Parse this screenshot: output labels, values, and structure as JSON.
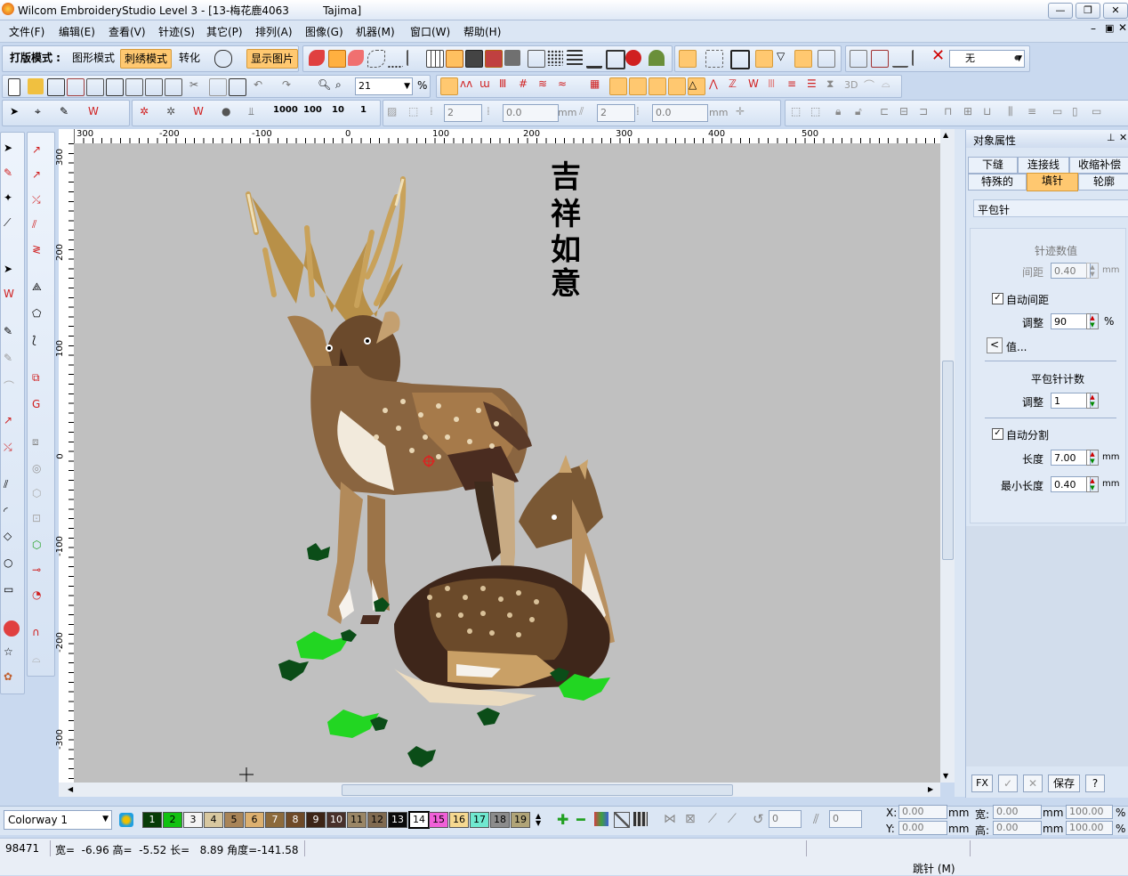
{
  "window": {
    "title": "Wilcom EmbroideryStudio Level 3 - [13-梅花鹿4063          Tajima]"
  },
  "menubar": {
    "items": [
      "文件(F)",
      "编辑(E)",
      "查看(V)",
      "针迹(S)",
      "其它(P)",
      "排列(A)",
      "图像(G)",
      "机器(M)",
      "窗口(W)",
      "帮助(H)"
    ]
  },
  "toolbar1": {
    "mode_label": "打版模式 :",
    "graphic_mode": "图形模式",
    "embroidery_mode": "刺绣模式",
    "convert": "转化",
    "show_image": "显示图片",
    "none_value": "无"
  },
  "toolbar2": {
    "zoom": "21",
    "percent": "%",
    "three_d": "3D"
  },
  "toolbar3": {
    "counts": [
      "1000",
      "100",
      "10",
      "1"
    ],
    "spin1": "2",
    "spin2": "0.0",
    "unit1": "mm",
    "spin3": "2",
    "spin4": "0.0",
    "unit2": "mm"
  },
  "ruler": {
    "h_labels": [
      "300",
      "-200",
      "-100",
      "0",
      "100",
      "200",
      "300",
      "400",
      "500"
    ],
    "v_labels": [
      "300",
      "200",
      "100",
      "0",
      "-100",
      "-200",
      "-300"
    ]
  },
  "canvas": {
    "calligraphy": [
      "吉",
      "祥",
      "如",
      "意"
    ],
    "background": "#c0c0c0"
  },
  "panel": {
    "title": "对象属性",
    "tabs_row1": [
      "下缝",
      "连接线",
      "收缩补偿"
    ],
    "tabs_row2": [
      "特殊的",
      "填针",
      "轮廓"
    ],
    "stitch_type": "平包针",
    "section1": "针迹数值",
    "spacing_label": "间距",
    "spacing_value": "0.40",
    "spacing_unit": "mm",
    "auto_spacing_label": "自动间距",
    "auto_spacing_checked": true,
    "adjust_label": "调整",
    "adjust_value": "90",
    "adjust_unit": "%",
    "values_button": "值...",
    "values_arrow": "<",
    "section2": "平包针计数",
    "count_adjust_label": "调整",
    "count_adjust_value": "1",
    "auto_split_label": "自动分割",
    "auto_split_checked": true,
    "length_label": "长度",
    "length_value": "7.00",
    "length_unit": "mm",
    "min_length_label": "最小长度",
    "min_length_value": "0.40",
    "min_length_unit": "mm",
    "buttons": {
      "fx": "FX",
      "ok": "✓",
      "cancel": "✕",
      "save": "保存",
      "help": "?"
    }
  },
  "colorbar": {
    "colorway": "Colorway 1",
    "swatches": [
      {
        "n": "1",
        "c": "#083c08",
        "fg": "#fff"
      },
      {
        "n": "2",
        "c": "#12c212",
        "fg": "#000"
      },
      {
        "n": "3",
        "c": "#f4f4f4",
        "fg": "#000"
      },
      {
        "n": "4",
        "c": "#d8c8a0",
        "fg": "#000"
      },
      {
        "n": "5",
        "c": "#a88458",
        "fg": "#000"
      },
      {
        "n": "6",
        "c": "#dcb070",
        "fg": "#000"
      },
      {
        "n": "7",
        "c": "#8c6a3c",
        "fg": "#fff"
      },
      {
        "n": "8",
        "c": "#6e4a28",
        "fg": "#fff"
      },
      {
        "n": "9",
        "c": "#3c2416",
        "fg": "#fff"
      },
      {
        "n": "10",
        "c": "#48302a",
        "fg": "#fff"
      },
      {
        "n": "11",
        "c": "#9a8666",
        "fg": "#000"
      },
      {
        "n": "12",
        "c": "#806a50",
        "fg": "#000"
      },
      {
        "n": "13",
        "c": "#0a0a0a",
        "fg": "#fff"
      },
      {
        "n": "14",
        "c": "#ffffff",
        "fg": "#000"
      },
      {
        "n": "15",
        "c": "#f060d8",
        "fg": "#000"
      },
      {
        "n": "16",
        "c": "#f6d890",
        "fg": "#000"
      },
      {
        "n": "17",
        "c": "#70e8d0",
        "fg": "#000"
      },
      {
        "n": "18",
        "c": "#8c8c8c",
        "fg": "#000"
      },
      {
        "n": "19",
        "c": "#b0a478",
        "fg": "#000"
      }
    ],
    "rot_value": "0",
    "slant_value": "0",
    "x_label": "X:",
    "x_value": "0.00",
    "y_label": "Y:",
    "y_value": "0.00",
    "unit": "mm",
    "w_label": "宽:",
    "w_value": "0.00",
    "h_label": "高:",
    "h_value": "0.00",
    "w_pct": "100.00",
    "h_pct": "100.00",
    "pct": "%"
  },
  "status": {
    "stitches": "98471",
    "info": "宽=  -6.96 高=  -5.52 长=   8.89 角度=-141.58",
    "mode": "跳针 (M)"
  }
}
